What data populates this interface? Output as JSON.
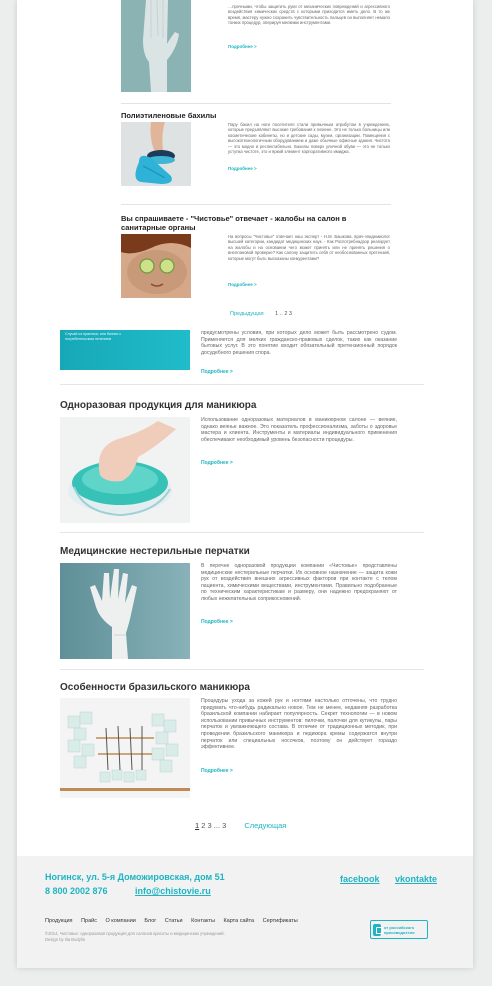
{
  "upper": {
    "item0": {
      "text": "…прочными, чтобы защитить руки от механических повреждений и агрессивного воздействия химических средств с которыми приходится иметь дело. В то же время, мастеру нужно сохранить чувствительность пальцев он выполняет немало тонких процедур, оперируя мелкими инструментами.",
      "more": "Подробнее >"
    },
    "item1": {
      "title": "Полиэтиленовые бахилы",
      "text": "Пару бахил на ноги посетителя стали привычным атрибутом в учреждениях, которые предъявляют высокие требования к гигиене. Это не только больницы или косметические кабинеты, но и детские сады, музеи, организации. Помещения с высокотехнологичным оборудованием и даже обычные офисные здания. Чистота — это модно и респектабельно. Бахилы поверх уличной обуви — это не только уступка чистоте, это и яркий элемент корпоративного имиджа.",
      "more": "Подробнее >"
    },
    "item2": {
      "title": "Вы спрашиваете - \"Чистовье\" отвечает - жалобы на салон в санитарные органы",
      "text": "На вопросы \"Чистовье\" отвечает наш эксперт - Н.М. Башкова, врач-эпидемиолог высшей категории, кандидат медицинских наук. - Как Роспотребнадзор реагирует на жалобы и на основании чего может принять или не принять решения о внеплановой проверке? Как салону защитить себя от необоснованных претензий, которые могут быть высказаны конкурентами?",
      "more": "Подробнее >"
    },
    "pagination": {
      "prev": "Предыдущая",
      "pages": "1 .. 2 3"
    }
  },
  "banner": {
    "text": "Случай из практики, или бизнес с потребительским лечением"
  },
  "wide": {
    "item0": {
      "text": "предусмотрены условия, при которых дело может быть рассмотрено судом. Применяется для мелких гражданско-правовых сделок, таких как оказание бытовых услуг. В это понятие входит обязательный претензионный порядок досудебного решения спора.",
      "more": "Подробнее >"
    },
    "item1": {
      "title": "Одноразовая продукция для маникюра",
      "text": "Использование одноразовых материалов в маникюрном салоне — веяние, однако веянье важное. Это показатель профессионализма, заботы о здоровье мастера и клиента. Инструменты и материалы индивидуального применения обеспечивают необходимый уровень безопасности процедуры.",
      "more": "Подробнее >"
    },
    "item2": {
      "title": "Медицинские нестерильные перчатки",
      "text": "В перечне одноразовой продукции компании «Чистовье» представлены медицинские нестерильные перчатки. Их основное назначение — защита кожи рук от воздействия внешних агрессивных факторов при контакте с телом пациента, химическими веществами, инструментами. Правильно подобранные по техническим характеристикам и размеру, они надежно предохраняют от любых нежелательных соприкосновений.",
      "more": "Подробнее >"
    },
    "item3": {
      "title": "Особенности бразильского маникюра",
      "text": "Процедуры ухода за кожей рук и ногтями настолько отточены, что трудно придумать что-нибудь радикально новое. Тем не менее, недавняя разработка бразильской компании набирает популярность. Секрет технологии — в новом использовании привычных инструментов: пилочки, палочки для кутикулы, пары перчаток и увлажняющего состава. В отличие от традиционных методик, при проведении бразильского маникюра и педикюра кремы содержатся внутри перчаток или специальных носочков, поэтому он действует гораздо эффективнее.",
      "more": "Подробнее >"
    },
    "pagination": {
      "current": "1",
      "pages": "2 3 ... 3",
      "next": "Следующая"
    }
  },
  "footer": {
    "address": "Ногинск, ул. 5-я Доможировская, дом 51",
    "phone": "8 800 2002 876",
    "email": "info@chistovie.ru",
    "facebook": "facebook",
    "vkontakte": "vkontakte",
    "nav": [
      "Продукция",
      "Прайс",
      "О компании",
      "Блог",
      "Статьи",
      "Контакты",
      "Карта сайта",
      "Сертификаты"
    ],
    "copyright": "©2014, Чистовье: одноразовая продукция для салонов красоты и медицинских учреждений.",
    "design": "Design by Ilia Budylin",
    "badge": "от российского производителя",
    "accent": "#1fb4c2"
  }
}
